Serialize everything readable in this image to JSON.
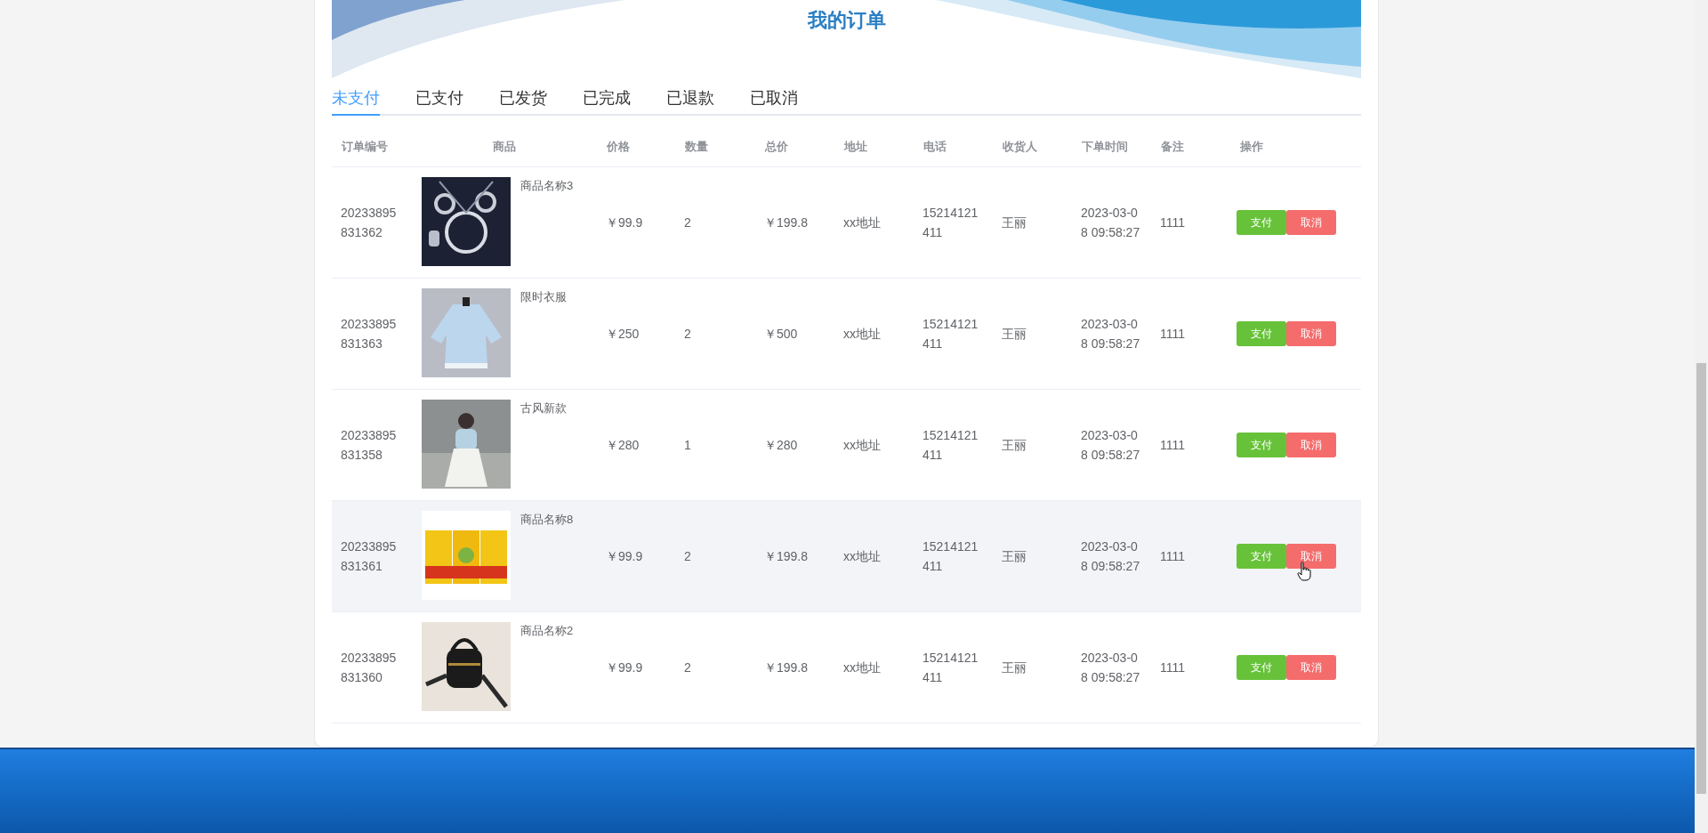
{
  "title": "我的订单",
  "tabs": [
    {
      "label": "未支付",
      "selected": true
    },
    {
      "label": "已支付",
      "selected": false
    },
    {
      "label": "已发货",
      "selected": false
    },
    {
      "label": "已完成",
      "selected": false
    },
    {
      "label": "已退款",
      "selected": false
    },
    {
      "label": "已取消",
      "selected": false
    }
  ],
  "table": {
    "columns": [
      "订单编号",
      "商品",
      "价格",
      "数量",
      "总价",
      "地址",
      "电话",
      "收货人",
      "下单时间",
      "备注",
      "操作"
    ],
    "rows": [
      {
        "order_no": "20233895831362",
        "product": {
          "name": "商品名称3"
        },
        "price": "￥99.9",
        "quantity": "2",
        "total": "￥199.8",
        "address": "xx地址",
        "phone": "15214121411",
        "receiver": "王丽",
        "time": "2023-03-08 09:58:27",
        "note": "1111",
        "actions": [
          "支付",
          "取消"
        ],
        "hovered": false
      },
      {
        "order_no": "20233895831363",
        "product": {
          "name": "限时衣服"
        },
        "price": "￥250",
        "quantity": "2",
        "total": "￥500",
        "address": "xx地址",
        "phone": "15214121411",
        "receiver": "王丽",
        "time": "2023-03-08 09:58:27",
        "note": "1111",
        "actions": [
          "支付",
          "取消"
        ],
        "hovered": false
      },
      {
        "order_no": "20233895831358",
        "product": {
          "name": "古风新款"
        },
        "price": "￥280",
        "quantity": "1",
        "total": "￥280",
        "address": "xx地址",
        "phone": "15214121411",
        "receiver": "王丽",
        "time": "2023-03-08 09:58:27",
        "note": "1111",
        "actions": [
          "支付",
          "取消"
        ],
        "hovered": false
      },
      {
        "order_no": "20233895831361",
        "product": {
          "name": "商品名称8"
        },
        "price": "￥99.9",
        "quantity": "2",
        "total": "￥199.8",
        "address": "xx地址",
        "phone": "15214121411",
        "receiver": "王丽",
        "time": "2023-03-08 09:58:27",
        "note": "1111",
        "actions": [
          "支付",
          "取消"
        ],
        "hovered": true
      },
      {
        "order_no": "20233895831360",
        "product": {
          "name": "商品名称2"
        },
        "price": "￥99.9",
        "quantity": "2",
        "total": "￥199.8",
        "address": "xx地址",
        "phone": "15214121411",
        "receiver": "王丽",
        "time": "2023-03-08 09:58:27",
        "note": "1111",
        "actions": [
          "支付",
          "取消"
        ],
        "hovered": false
      }
    ]
  }
}
